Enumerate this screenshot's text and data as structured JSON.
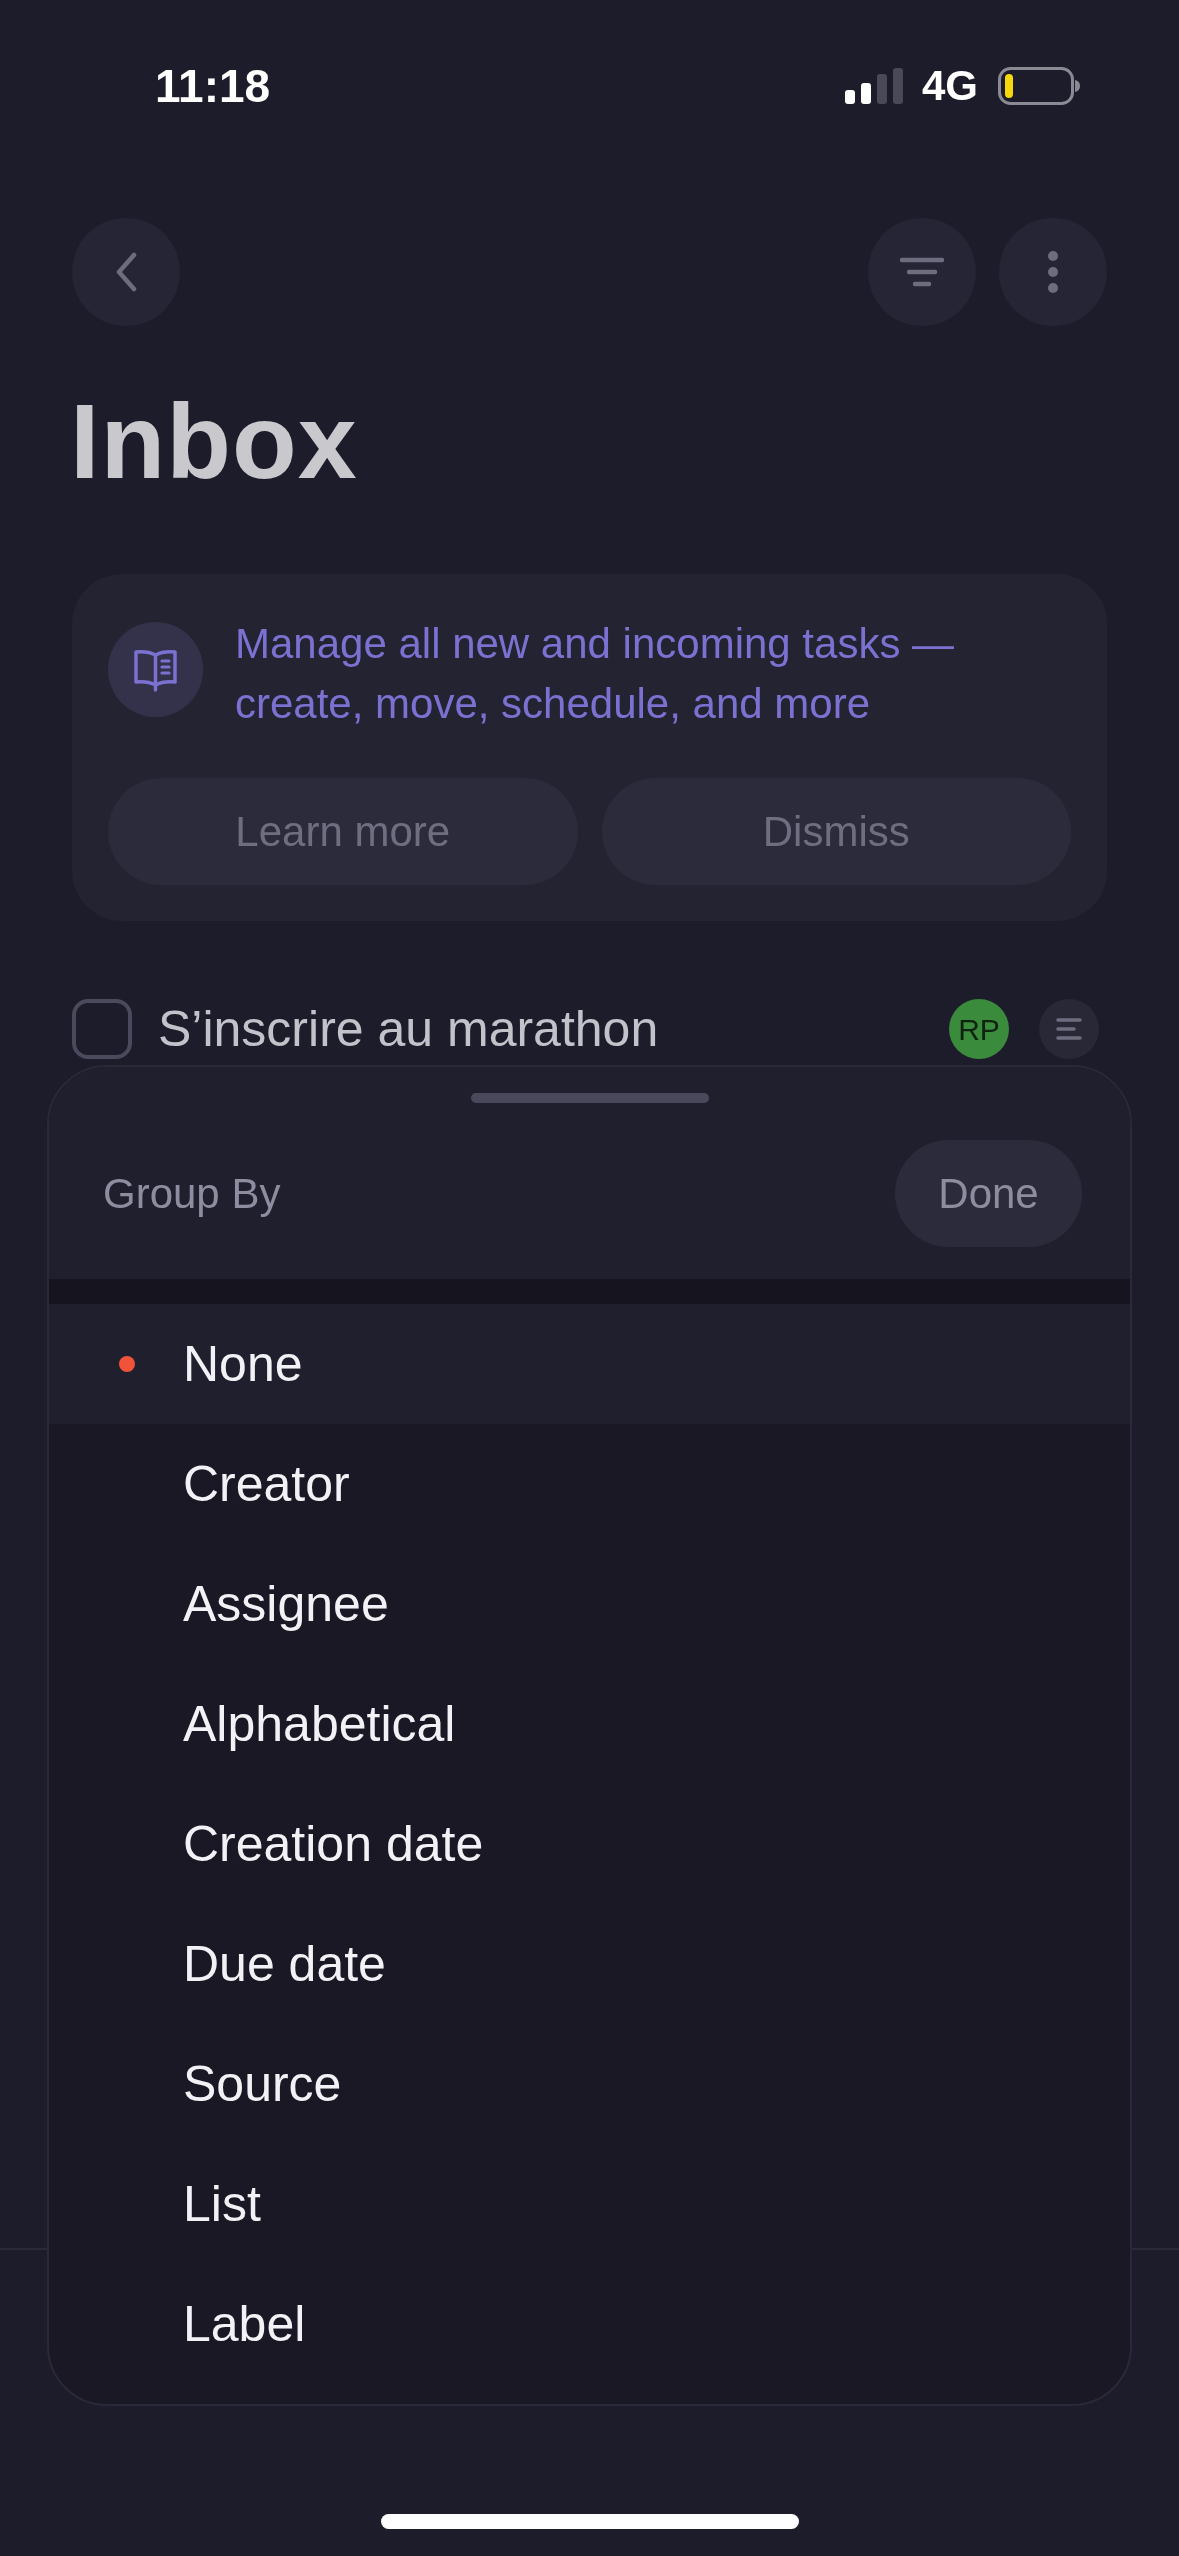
{
  "status_bar": {
    "time": "11:18",
    "network": "4G"
  },
  "header": {
    "title": "Inbox"
  },
  "banner": {
    "text": "Manage all new and incoming tasks — create, move, schedule, and more",
    "buttons": [
      "Learn more",
      "Dismiss"
    ]
  },
  "tasks": [
    {
      "title": "S’inscrire au marathon",
      "checked": false,
      "assignee": {
        "initials": "RP",
        "color": "#3b8b3d"
      }
    }
  ],
  "sheet": {
    "title": "Group By",
    "done": "Done",
    "options": [
      {
        "label": "None",
        "selected": true
      },
      {
        "label": "Creator",
        "selected": false
      },
      {
        "label": "Assignee",
        "selected": false
      },
      {
        "label": "Alphabetical",
        "selected": false
      },
      {
        "label": "Creation date",
        "selected": false
      },
      {
        "label": "Due date",
        "selected": false
      },
      {
        "label": "Source",
        "selected": false
      },
      {
        "label": "List",
        "selected": false
      },
      {
        "label": "Label",
        "selected": false
      }
    ]
  }
}
